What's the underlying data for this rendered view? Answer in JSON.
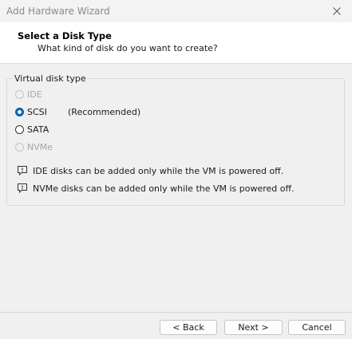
{
  "window": {
    "title": "Add Hardware Wizard",
    "close_icon": "close-icon"
  },
  "header": {
    "title": "Select a Disk Type",
    "subtitle": "What kind of disk do you want to create?"
  },
  "disk_type": {
    "legend": "Virtual disk type",
    "options": [
      {
        "label": "IDE",
        "enabled": false,
        "checked": false
      },
      {
        "label": "SCSI",
        "enabled": true,
        "checked": true,
        "note": "(Recommended)"
      },
      {
        "label": "SATA",
        "enabled": true,
        "checked": false
      },
      {
        "label": "NVMe",
        "enabled": false,
        "checked": false
      }
    ]
  },
  "notes": [
    {
      "icon": "info-comment-icon",
      "text": "IDE disks can be added only while the VM is powered off."
    },
    {
      "icon": "info-comment-icon",
      "text": "NVMe disks can be added only while the VM is powered off."
    }
  ],
  "buttons": {
    "back": "< Back",
    "next": "Next >",
    "cancel": "Cancel"
  },
  "colors": {
    "accent": "#0062ad",
    "disabled": "#a6a6a6"
  }
}
